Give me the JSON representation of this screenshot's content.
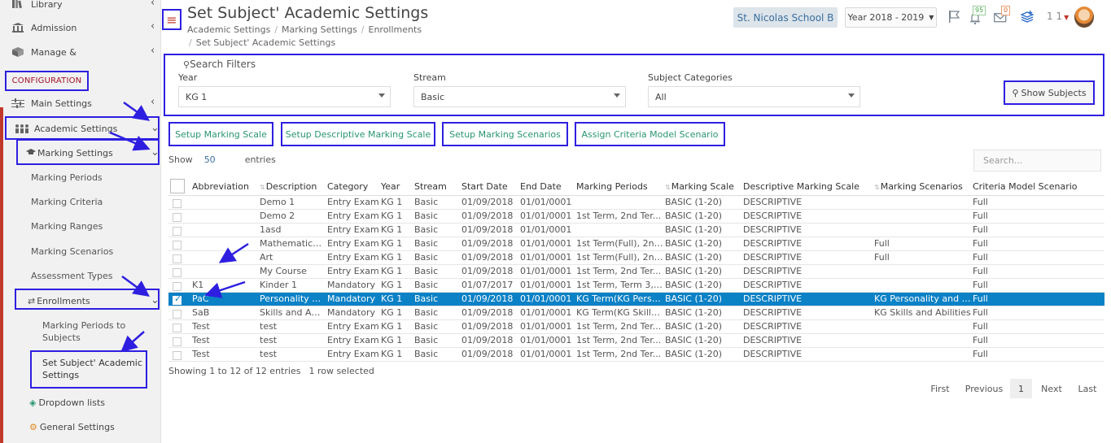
{
  "sidebar": {
    "items": [
      {
        "label": "Library"
      },
      {
        "label": "Admission"
      },
      {
        "label": "Manage &"
      }
    ],
    "section_label": "CONFIGURATION",
    "config_items": [
      {
        "label": "Main Settings"
      },
      {
        "label": "Academic Settings"
      },
      {
        "label": "Marking Settings"
      }
    ],
    "marking_sub": [
      "Marking Periods",
      "Marking Criteria",
      "Marking Ranges",
      "Marking Scenarios",
      "Assessment Types"
    ],
    "enrollments_label": "Enrollments",
    "enroll_sub_1": "Marking Periods to",
    "enroll_sub_1b": "Subjects",
    "enroll_sub_2": "Set Subject' Academic",
    "enroll_sub_2b": "Settings",
    "dropdown_lists": "Dropdown lists",
    "general_settings": "General Settings"
  },
  "header": {
    "title": "Set Subject' Academic Settings",
    "breadcrumbs": [
      "Academic Settings",
      "Marking Settings",
      "Enrollments",
      "Set Subject' Academic Settings"
    ],
    "school": "St. Nicolas School B",
    "year": "Year 2018 - 2019",
    "notif_count": "95",
    "mail_count": "0",
    "user_num": "1 1"
  },
  "filters": {
    "legend": "Search Filters",
    "year_label": "Year",
    "year_value": "KG 1",
    "stream_label": "Stream",
    "stream_value": "Basic",
    "category_label": "Subject Categories",
    "category_value": "All",
    "show_btn": "Show Subjects"
  },
  "actions": [
    "Setup Marking Scale",
    "Setup Descriptive Marking Scale",
    "Setup Marking Scenarios",
    "Assign Criteria Model Scenario"
  ],
  "table_controls": {
    "show": "Show",
    "page_size": "50",
    "entries": "entries",
    "search_placeholder": "Search..."
  },
  "table": {
    "columns": [
      "Abbreviation",
      "Description",
      "Category",
      "Year",
      "Stream",
      "Start Date",
      "End Date",
      "Marking Periods",
      "Marking Scale",
      "Descriptive Marking Scale",
      "Marking Scenarios",
      "Criteria Model Scenario"
    ],
    "rows": [
      {
        "abbr": "",
        "desc": "Demo 1",
        "cat": "Entry Exam",
        "year": "KG 1",
        "stream": "Basic",
        "start": "01/09/2018",
        "end": "01/01/0001",
        "periods": "",
        "scale": "BASIC (1-20)",
        "dms": "DESCRIPTIVE",
        "scen": "",
        "crit": "Full",
        "selected": false
      },
      {
        "abbr": "",
        "desc": "Demo 2",
        "cat": "Entry Exam",
        "year": "KG 1",
        "stream": "Basic",
        "start": "01/09/2018",
        "end": "01/01/0001",
        "periods": "1st Term, 2nd Ter...",
        "scale": "BASIC (1-20)",
        "dms": "DESCRIPTIVE",
        "scen": "",
        "crit": "Full",
        "selected": false
      },
      {
        "abbr": "",
        "desc": "1asd",
        "cat": "Entry Exam",
        "year": "KG 1",
        "stream": "Basic",
        "start": "01/09/2018",
        "end": "01/01/0001",
        "periods": "",
        "scale": "BASIC (1-20)",
        "dms": "DESCRIPTIVE",
        "scen": "",
        "crit": "Full",
        "selected": false
      },
      {
        "abbr": "",
        "desc": "Mathematics ...",
        "cat": "Entry Exam",
        "year": "KG 1",
        "stream": "Basic",
        "start": "01/09/2018",
        "end": "01/01/0001",
        "periods": "1st Term(Full), 2nd...",
        "scale": "BASIC (1-20)",
        "dms": "DESCRIPTIVE",
        "scen": "Full",
        "crit": "Full",
        "selected": false
      },
      {
        "abbr": "",
        "desc": "Art",
        "cat": "Entry Exam",
        "year": "KG 1",
        "stream": "Basic",
        "start": "01/09/2018",
        "end": "01/01/0001",
        "periods": "1st Term(Full), 2nd...",
        "scale": "BASIC (1-20)",
        "dms": "DESCRIPTIVE",
        "scen": "Full",
        "crit": "Full",
        "selected": false
      },
      {
        "abbr": "",
        "desc": "My Course",
        "cat": "Entry Exam",
        "year": "KG 1",
        "stream": "Basic",
        "start": "01/09/2018",
        "end": "01/01/0001",
        "periods": "1st Term, 2nd Ter...",
        "scale": "BASIC (1-20)",
        "dms": "DESCRIPTIVE",
        "scen": "",
        "crit": "Full",
        "selected": false
      },
      {
        "abbr": "K1",
        "desc": "Kinder 1",
        "cat": "Mandatory",
        "year": "KG 1",
        "stream": "Basic",
        "start": "01/07/2017",
        "end": "01/01/0001",
        "periods": "1st Term, Term 3, ...",
        "scale": "BASIC (1-20)",
        "dms": "DESCRIPTIVE",
        "scen": "",
        "crit": "Full",
        "selected": false
      },
      {
        "abbr": "PaC",
        "desc": "Personality a...",
        "cat": "Mandatory",
        "year": "KG 1",
        "stream": "Basic",
        "start": "01/09/2018",
        "end": "01/01/0001",
        "periods": "KG Term(KG Perso...",
        "scale": "BASIC (1-20)",
        "dms": "DESCRIPTIVE",
        "scen": "KG Personality and C...",
        "crit": "Full",
        "selected": true
      },
      {
        "abbr": "SaB",
        "desc": "Skills and Abil...",
        "cat": "Mandatory",
        "year": "KG 1",
        "stream": "Basic",
        "start": "01/09/2018",
        "end": "01/01/0001",
        "periods": "KG Term(KG Skills ...",
        "scale": "BASIC (1-20)",
        "dms": "DESCRIPTIVE",
        "scen": "KG Skills and Abilities",
        "crit": "Full",
        "selected": false
      },
      {
        "abbr": "Test",
        "desc": "test",
        "cat": "Entry Exam",
        "year": "KG 1",
        "stream": "Basic",
        "start": "01/09/2018",
        "end": "01/01/0001",
        "periods": "1st Term, 2nd Ter...",
        "scale": "BASIC (1-20)",
        "dms": "DESCRIPTIVE",
        "scen": "",
        "crit": "Full",
        "selected": false
      },
      {
        "abbr": "Test",
        "desc": "test",
        "cat": "Entry Exam",
        "year": "KG 1",
        "stream": "Basic",
        "start": "01/09/2018",
        "end": "01/01/0001",
        "periods": "1st Term, 2nd Ter...",
        "scale": "BASIC (1-20)",
        "dms": "DESCRIPTIVE",
        "scen": "",
        "crit": "Full",
        "selected": false
      },
      {
        "abbr": "Test",
        "desc": "test",
        "cat": "Entry Exam",
        "year": "KG 1",
        "stream": "Basic",
        "start": "01/09/2018",
        "end": "01/01/0001",
        "periods": "1st Term, 2nd Ter...",
        "scale": "BASIC (1-20)",
        "dms": "DESCRIPTIVE",
        "scen": "",
        "crit": "Full",
        "selected": false
      }
    ],
    "info": "Showing 1 to 12 of 12 entries",
    "selection_info": "1 row selected",
    "pager": {
      "first": "First",
      "previous": "Previous",
      "current": "1",
      "next": "Next",
      "last": "Last"
    }
  },
  "colors": {
    "annotation": "#2e1fe0",
    "accent_red": "#c0392b",
    "selected_row": "#0b81c6",
    "link_green": "#28966e"
  }
}
